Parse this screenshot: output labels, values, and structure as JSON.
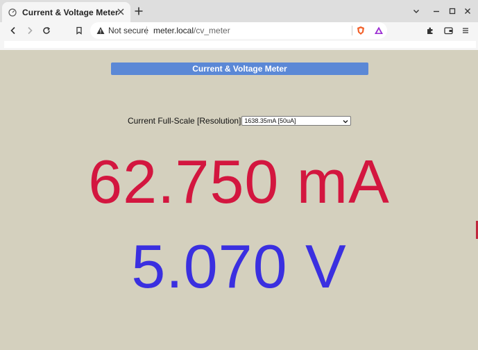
{
  "browser": {
    "tab": {
      "title": "Current & Voltage Meter"
    },
    "address_bar": {
      "security_label": "Not secure",
      "url_host": "meter.local",
      "url_path": "/cv_meter"
    }
  },
  "page": {
    "header": "Current & Voltage Meter",
    "full_scale": {
      "label": "Current Full-Scale [Resolution]",
      "selected_option": "1638.35mA [50uA]"
    },
    "current_reading": "62.750 mA",
    "voltage_reading": "5.070 V"
  },
  "colors": {
    "page_background": "#d4d0be",
    "header_bar": "#5b88d6",
    "current_text": "#d3163f",
    "voltage_text": "#3a2fe0"
  },
  "icons": [
    "gauge-icon",
    "close-icon",
    "plus-icon",
    "chevron-down-icon",
    "minimize-icon",
    "maximize-icon",
    "close-window-icon",
    "back-icon",
    "forward-icon",
    "reload-icon",
    "bookmark-icon",
    "warning-icon",
    "brave-shield-icon",
    "brave-rewards-icon",
    "extensions-icon",
    "wallet-icon",
    "menu-icon"
  ]
}
